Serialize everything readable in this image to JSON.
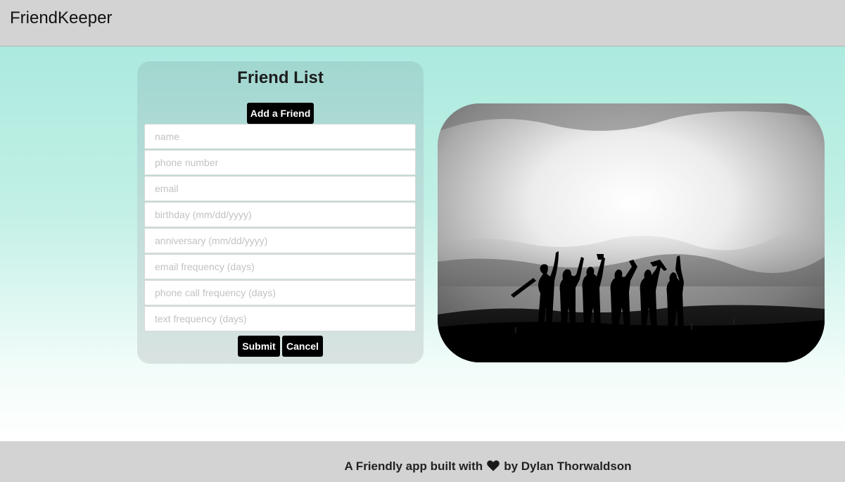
{
  "app": {
    "brand": "FriendKeeper"
  },
  "form": {
    "title": "Friend List",
    "add_button": "Add a Friend",
    "fields": [
      {
        "placeholder": "name",
        "value": ""
      },
      {
        "placeholder": "phone number",
        "value": ""
      },
      {
        "placeholder": "email",
        "value": ""
      },
      {
        "placeholder": "birthday (mm/dd/yyyy)",
        "value": ""
      },
      {
        "placeholder": "anniversary (mm/dd/yyyy)",
        "value": ""
      },
      {
        "placeholder": "email frequency (days)",
        "value": ""
      },
      {
        "placeholder": "phone call frequency (days)",
        "value": ""
      },
      {
        "placeholder": "text frequency (days)",
        "value": ""
      }
    ],
    "submit_button": "Submit",
    "cancel_button": "Cancel"
  },
  "hero_image": {
    "subject": "silhouette of friends waving on a hilltop"
  },
  "footer": {
    "text_before": "A Friendly app built with",
    "icon": "heart-icon",
    "text_after": "by Dylan Thorwaldson"
  },
  "colors": {
    "navbar_bg": "#d3d3d3",
    "button_bg": "#000000",
    "button_text": "#ffffff",
    "page_gradient_top": "#a6e8dc",
    "page_gradient_bottom": "#ffffff"
  }
}
